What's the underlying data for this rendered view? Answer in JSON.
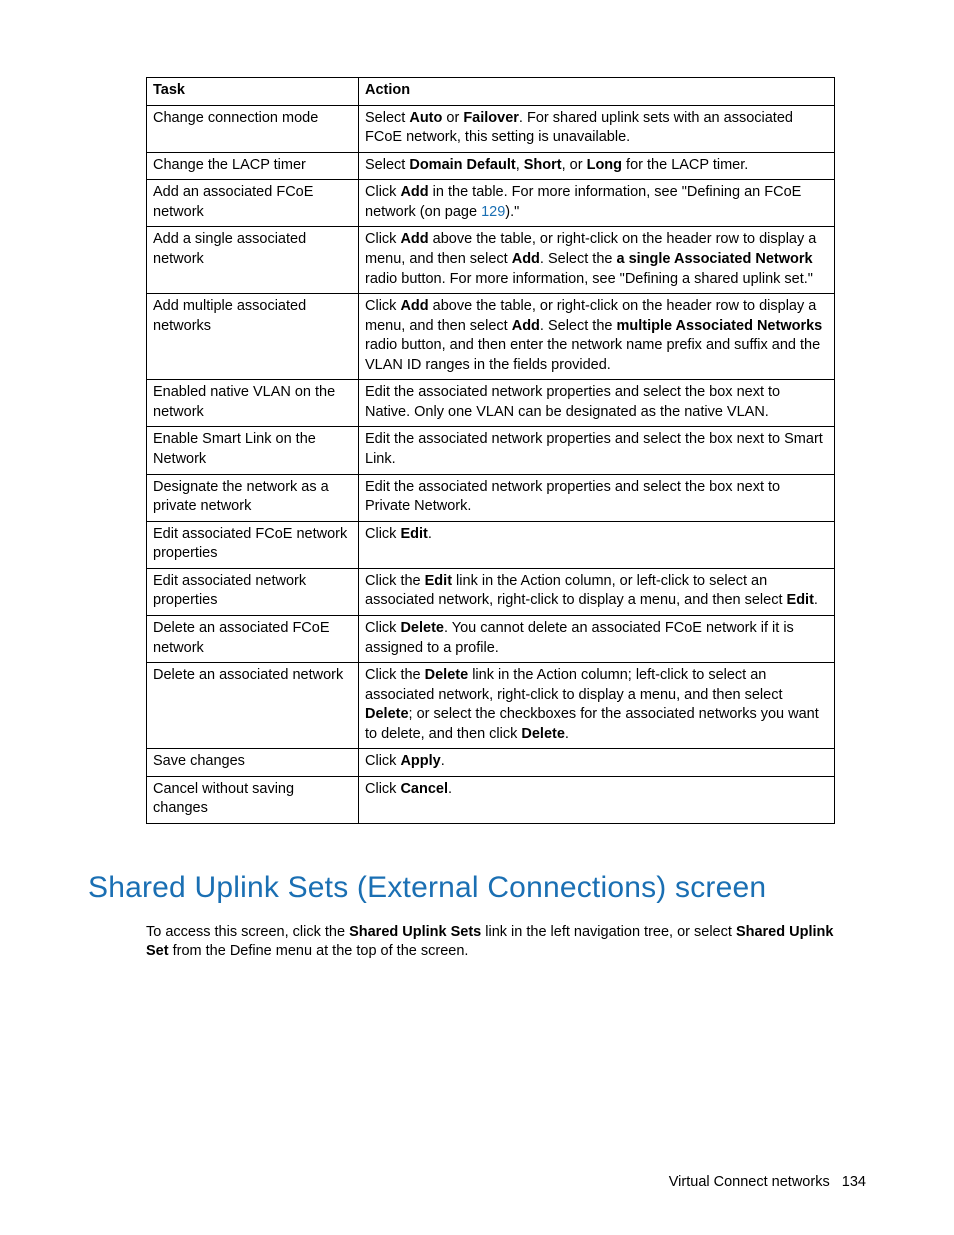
{
  "table": {
    "headers": {
      "task": "Task",
      "action": "Action"
    },
    "rows": [
      {
        "task": "Change connection mode",
        "action_parts": [
          "Select ",
          "Auto",
          " or ",
          "Failover",
          ". For shared uplink sets with an associated FCoE network, this setting is unavailable."
        ]
      },
      {
        "task": "Change the LACP timer",
        "action_parts": [
          "Select ",
          "Domain Default",
          ", ",
          "Short",
          ", or ",
          "Long",
          " for the LACP timer."
        ]
      },
      {
        "task": "Add an associated FCoE network",
        "action_parts": [
          "Click ",
          "Add",
          " in the table. For more information, see \"Defining an FCoE network (on page ",
          "LINK:129",
          ").\""
        ]
      },
      {
        "task": "Add a single associated network",
        "action_parts": [
          "Click ",
          "Add",
          " above the table, or right-click on the header row to display a menu, and then select ",
          "Add",
          ". Select the ",
          "a single Associated Network",
          " radio button. For more information, see \"Defining a shared uplink set.\""
        ]
      },
      {
        "task": "Add multiple associated networks",
        "action_parts": [
          "Click ",
          "Add",
          " above the table, or right-click on the header row to display a menu, and then select ",
          "Add",
          ". Select the ",
          "multiple Associated Networks",
          " radio button, and then enter the network name prefix and suffix and the VLAN ID ranges in the fields provided."
        ]
      },
      {
        "task": "Enabled native VLAN on the network",
        "action_parts": [
          "Edit the associated network properties and select the box next to Native. Only one VLAN can be designated as the native VLAN."
        ]
      },
      {
        "task": "Enable Smart Link on the Network",
        "action_parts": [
          "Edit the associated network properties and select the box next to Smart Link."
        ]
      },
      {
        "task": "Designate the network as a private network",
        "action_parts": [
          "Edit the associated network properties and select the box next to Private Network."
        ]
      },
      {
        "task": "Edit associated FCoE network properties",
        "action_parts": [
          "Click ",
          "Edit",
          "."
        ]
      },
      {
        "task": "Edit associated network properties",
        "action_parts": [
          "Click the ",
          "Edit",
          " link in the Action column, or left-click to select an associated network, right-click to display a menu, and then select ",
          "Edit",
          "."
        ]
      },
      {
        "task": "Delete an associated FCoE network",
        "action_parts": [
          "Click ",
          "Delete",
          ". You cannot delete an associated FCoE network if it is assigned to a profile."
        ]
      },
      {
        "task": "Delete an associated network",
        "action_parts": [
          "Click the ",
          "Delete",
          " link in the Action column; left-click to select an associated network, right-click to display a menu, and then select ",
          "Delete",
          "; or select the checkboxes for the associated networks you want to delete, and then click ",
          "Delete",
          "."
        ]
      },
      {
        "task": "Save changes",
        "action_parts": [
          "Click ",
          "Apply",
          "."
        ]
      },
      {
        "task": "Cancel without saving changes",
        "action_parts": [
          "Click ",
          "Cancel",
          "."
        ]
      }
    ]
  },
  "section": {
    "title": "Shared Uplink Sets (External Connections) screen",
    "intro_parts": [
      "To access this screen, click the ",
      "Shared Uplink Sets",
      " link in the left navigation tree, or select ",
      "Shared Uplink Set",
      " from the Define menu at the top of the screen."
    ]
  },
  "footer": {
    "label": "Virtual Connect networks",
    "page": "134"
  }
}
